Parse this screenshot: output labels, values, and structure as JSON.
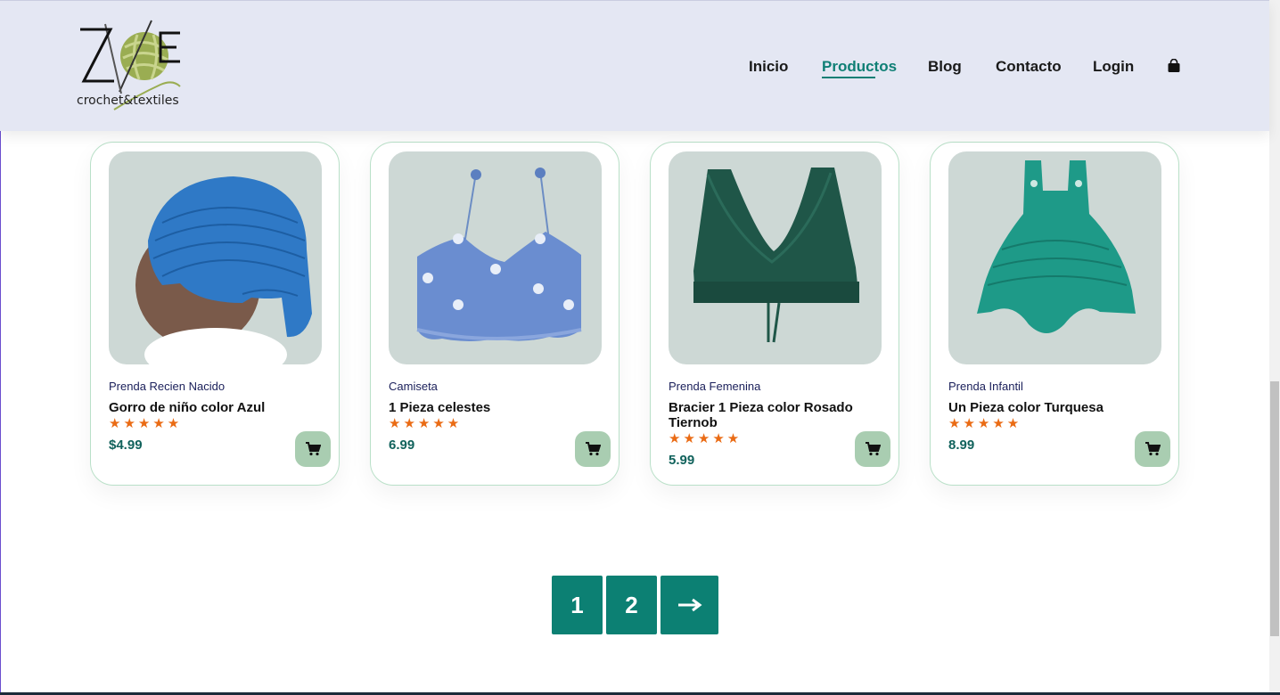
{
  "brand": {
    "logo_letters": "ZOE",
    "tagline": "crochet&textiles"
  },
  "nav": {
    "items": [
      {
        "label": "Inicio",
        "active": false
      },
      {
        "label": "Productos",
        "active": true
      },
      {
        "label": "Blog",
        "active": false
      },
      {
        "label": "Contacto",
        "active": false
      },
      {
        "label": "Login",
        "active": false
      }
    ],
    "cart_icon": "shopping-bag-icon"
  },
  "products": [
    {
      "category": "Prenda Recien Nacido",
      "name": "Gorro de niño color Azul",
      "rating": 5,
      "stars": "★★★★★",
      "price": "$4.99",
      "image": "blue crochet baby hat"
    },
    {
      "category": "Camiseta",
      "name": "1 Pieza celestes",
      "rating": 5,
      "stars": "★★★★★",
      "price": "6.99",
      "image": "light blue crochet top with flowers"
    },
    {
      "category": "Prenda Femenina",
      "name": "Bracier 1 Pieza color Rosado Tiernob",
      "rating": 5,
      "stars": "★★★★★",
      "price": "5.99",
      "image": "dark green crochet bralette"
    },
    {
      "category": "Prenda Infantil",
      "name": "Un Pieza color Turquesa",
      "rating": 5,
      "stars": "★★★★★",
      "price": "8.99",
      "image": "turquoise crochet romper"
    }
  ],
  "pagination": {
    "pages": [
      "1",
      "2"
    ],
    "next_icon": "arrow-right-icon",
    "next_label": "⟶"
  },
  "colors": {
    "accent": "#0c8073",
    "header_bg": "#e4e7f3",
    "star": "#ea6b14",
    "cart_button": "#a9cdb1"
  }
}
